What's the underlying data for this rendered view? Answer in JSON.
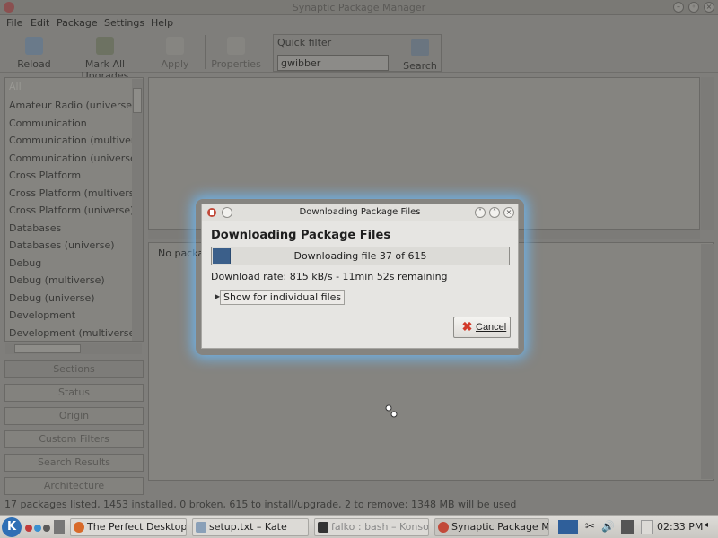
{
  "main_window": {
    "title": "Synaptic Package Manager",
    "menus": [
      "File",
      "Edit",
      "Package",
      "Settings",
      "Help"
    ],
    "toolbar": {
      "reload": "Reload",
      "mark_all_upgrades": "Mark All Upgrades",
      "apply": "Apply",
      "properties": "Properties",
      "quick_filter_label": "Quick filter",
      "quick_filter_value": "gwibber",
      "search": "Search"
    },
    "sidebar": {
      "items": [
        "All",
        "Amateur Radio (universe)",
        "Communication",
        "Communication (multiverse)",
        "Communication (universe)",
        "Cross Platform",
        "Cross Platform (multiverse)",
        "Cross Platform (universe)",
        "Databases",
        "Databases (universe)",
        "Debug",
        "Debug (multiverse)",
        "Debug (universe)",
        "Development",
        "Development (multiverse)"
      ],
      "buttons": [
        "Sections",
        "Status",
        "Origin",
        "Custom Filters",
        "Search Results",
        "Architecture"
      ]
    },
    "description_pane": {
      "text": "No packa"
    },
    "status_text": "17 packages listed, 1453 installed, 0 broken, 615 to install/upgrade, 2 to remove; 1348 MB will be used"
  },
  "dialog": {
    "title": "Downloading Package Files",
    "heading": "Downloading Package Files",
    "progress": {
      "text": "Downloading file 37 of 615",
      "fraction": 0.06
    },
    "rate": "Download rate: 815 kB/s - 11min 52s remaining",
    "expander_label": "Show for individual files",
    "cancel_label": "Cancel"
  },
  "taskbar": {
    "tasks": [
      "The Perfect Desktop - X",
      "setup.txt – Kate",
      "falko : bash – Konsole",
      "Synaptic Package Manag"
    ],
    "clock": "02:33 PM"
  },
  "colors": {
    "accent_glow": "#6fb2e6",
    "progress_fill": "#3b5f8a",
    "cancel_icon": "#d23a2a"
  }
}
